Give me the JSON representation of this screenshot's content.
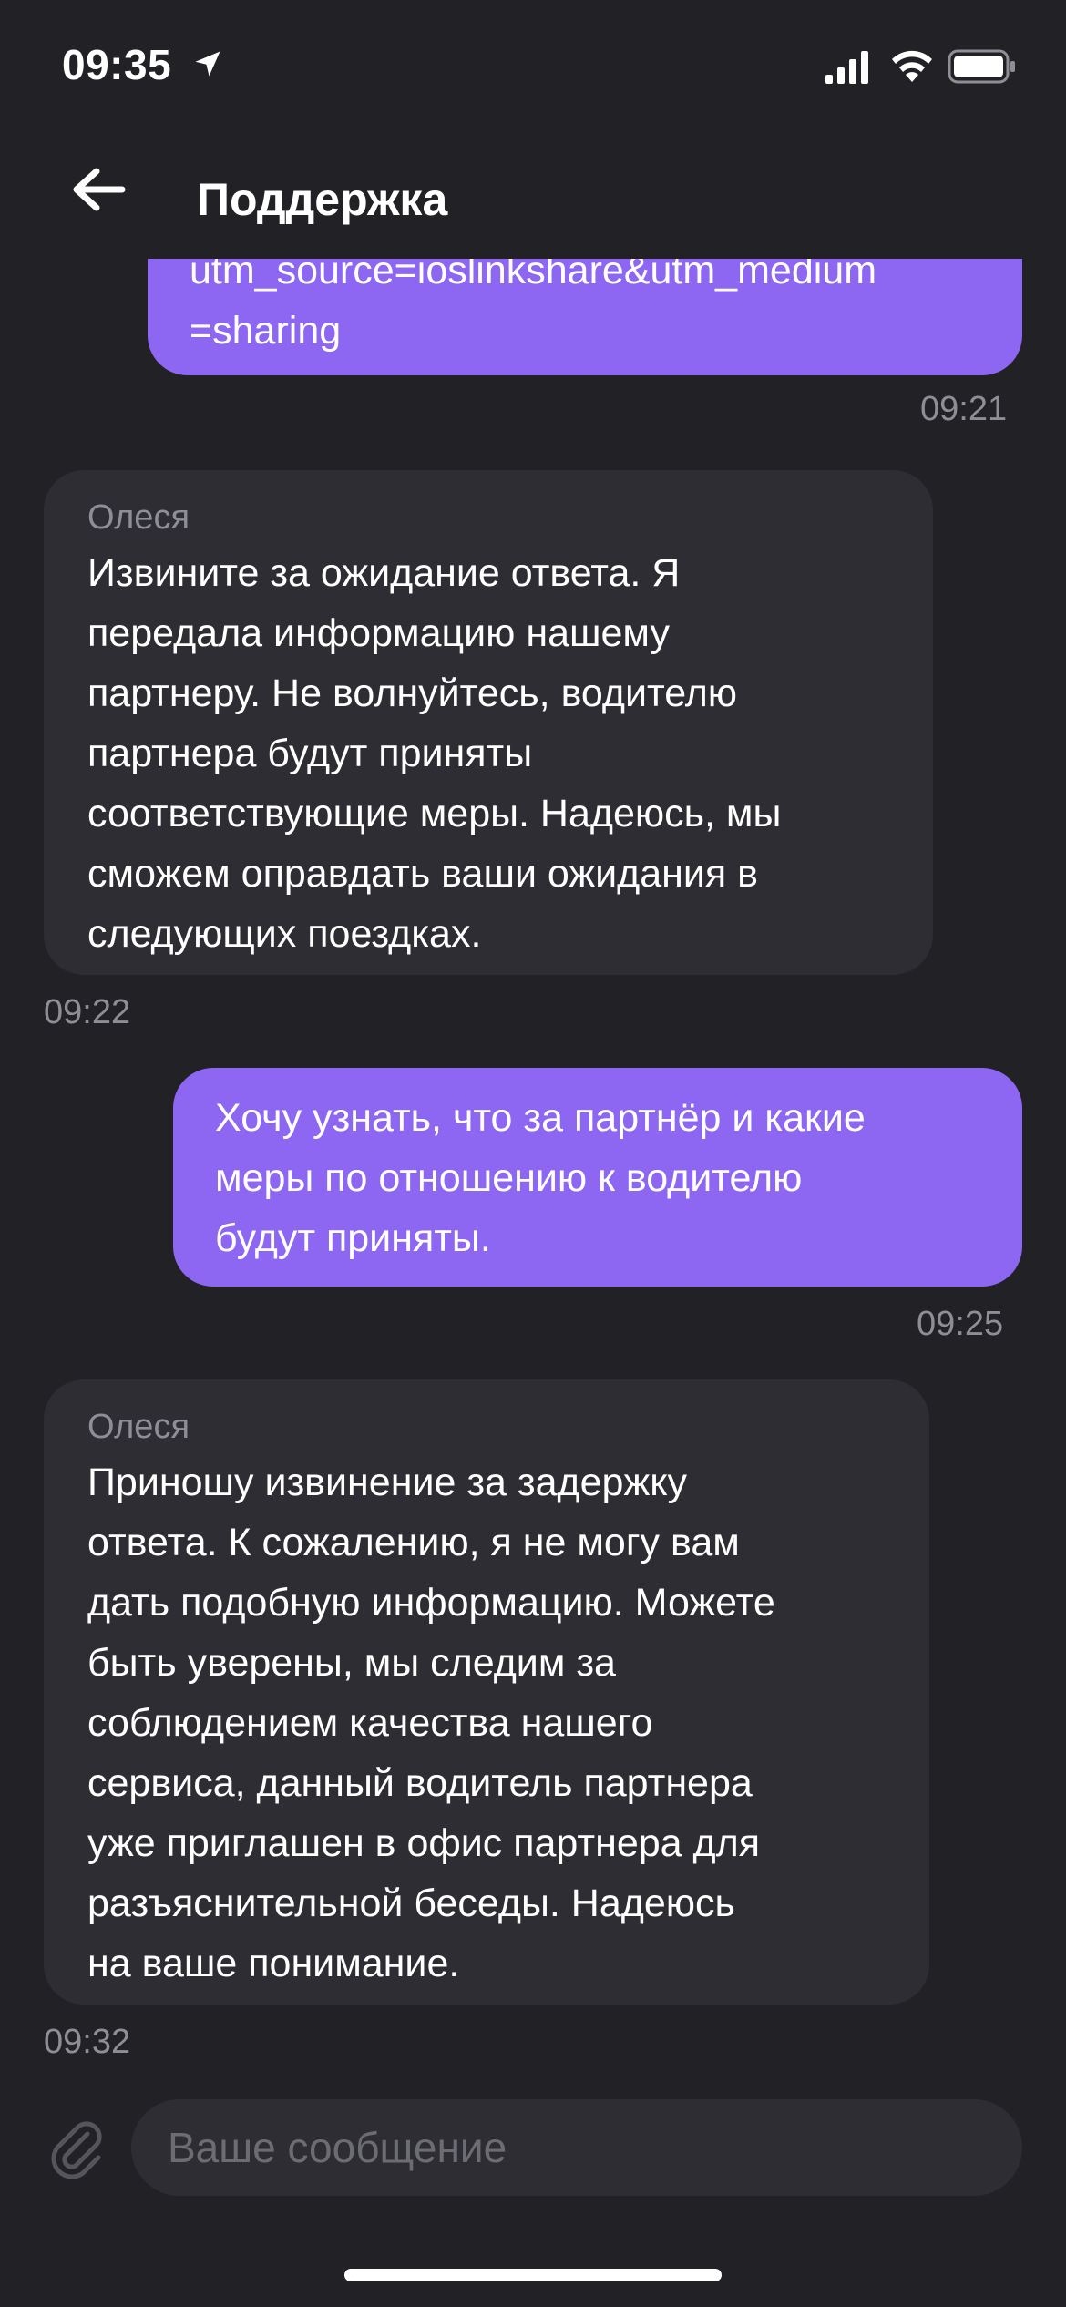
{
  "status_bar": {
    "time": "09:35",
    "icons": [
      "location-arrow-icon",
      "cellular-signal-icon",
      "wifi-icon",
      "battery-icon"
    ]
  },
  "header": {
    "back_icon": "arrow-left-icon",
    "title": "Поддержка"
  },
  "messages": [
    {
      "direction": "outgoing",
      "text": "utm_source=ioslinkshare&utm_medium\n=sharing",
      "time": "09:21"
    },
    {
      "direction": "incoming",
      "sender": "Олеся",
      "text": "Извините за ожидание ответа. Я\nпередала информацию нашему\nпартнеру. Не волнуйтесь, водителю\nпартнера будут приняты\nсоответствующие меры. Надеюсь, мы\nсможем оправдать ваши ожидания в\nследующих поездках.",
      "time": "09:22"
    },
    {
      "direction": "outgoing",
      "text": "Хочу узнать, что за партнёр и какие\nмеры по отношению к водителю\nбудут приняты.",
      "time": "09:25"
    },
    {
      "direction": "incoming",
      "sender": "Олеся",
      "text": "Приношу извинение за задержку\nответа. К сожалению, я не могу вам\nдать подобную информацию. Можете\nбыть уверены, мы следим за\nсоблюдением качества нашего\nсервиса, данный водитель партнера\nуже приглашен в офис партнера для\nразъяснительной беседы.  Надеюсь\nна ваше понимание.",
      "time": "09:32"
    }
  ],
  "composer": {
    "attach_icon": "paperclip-icon",
    "placeholder": "Ваше сообщение",
    "value": ""
  },
  "colors": {
    "background": "#212126",
    "outgoing_bubble": "#8d66f2",
    "incoming_bubble": "#2d2d33",
    "secondary_text": "#8e8e96"
  }
}
